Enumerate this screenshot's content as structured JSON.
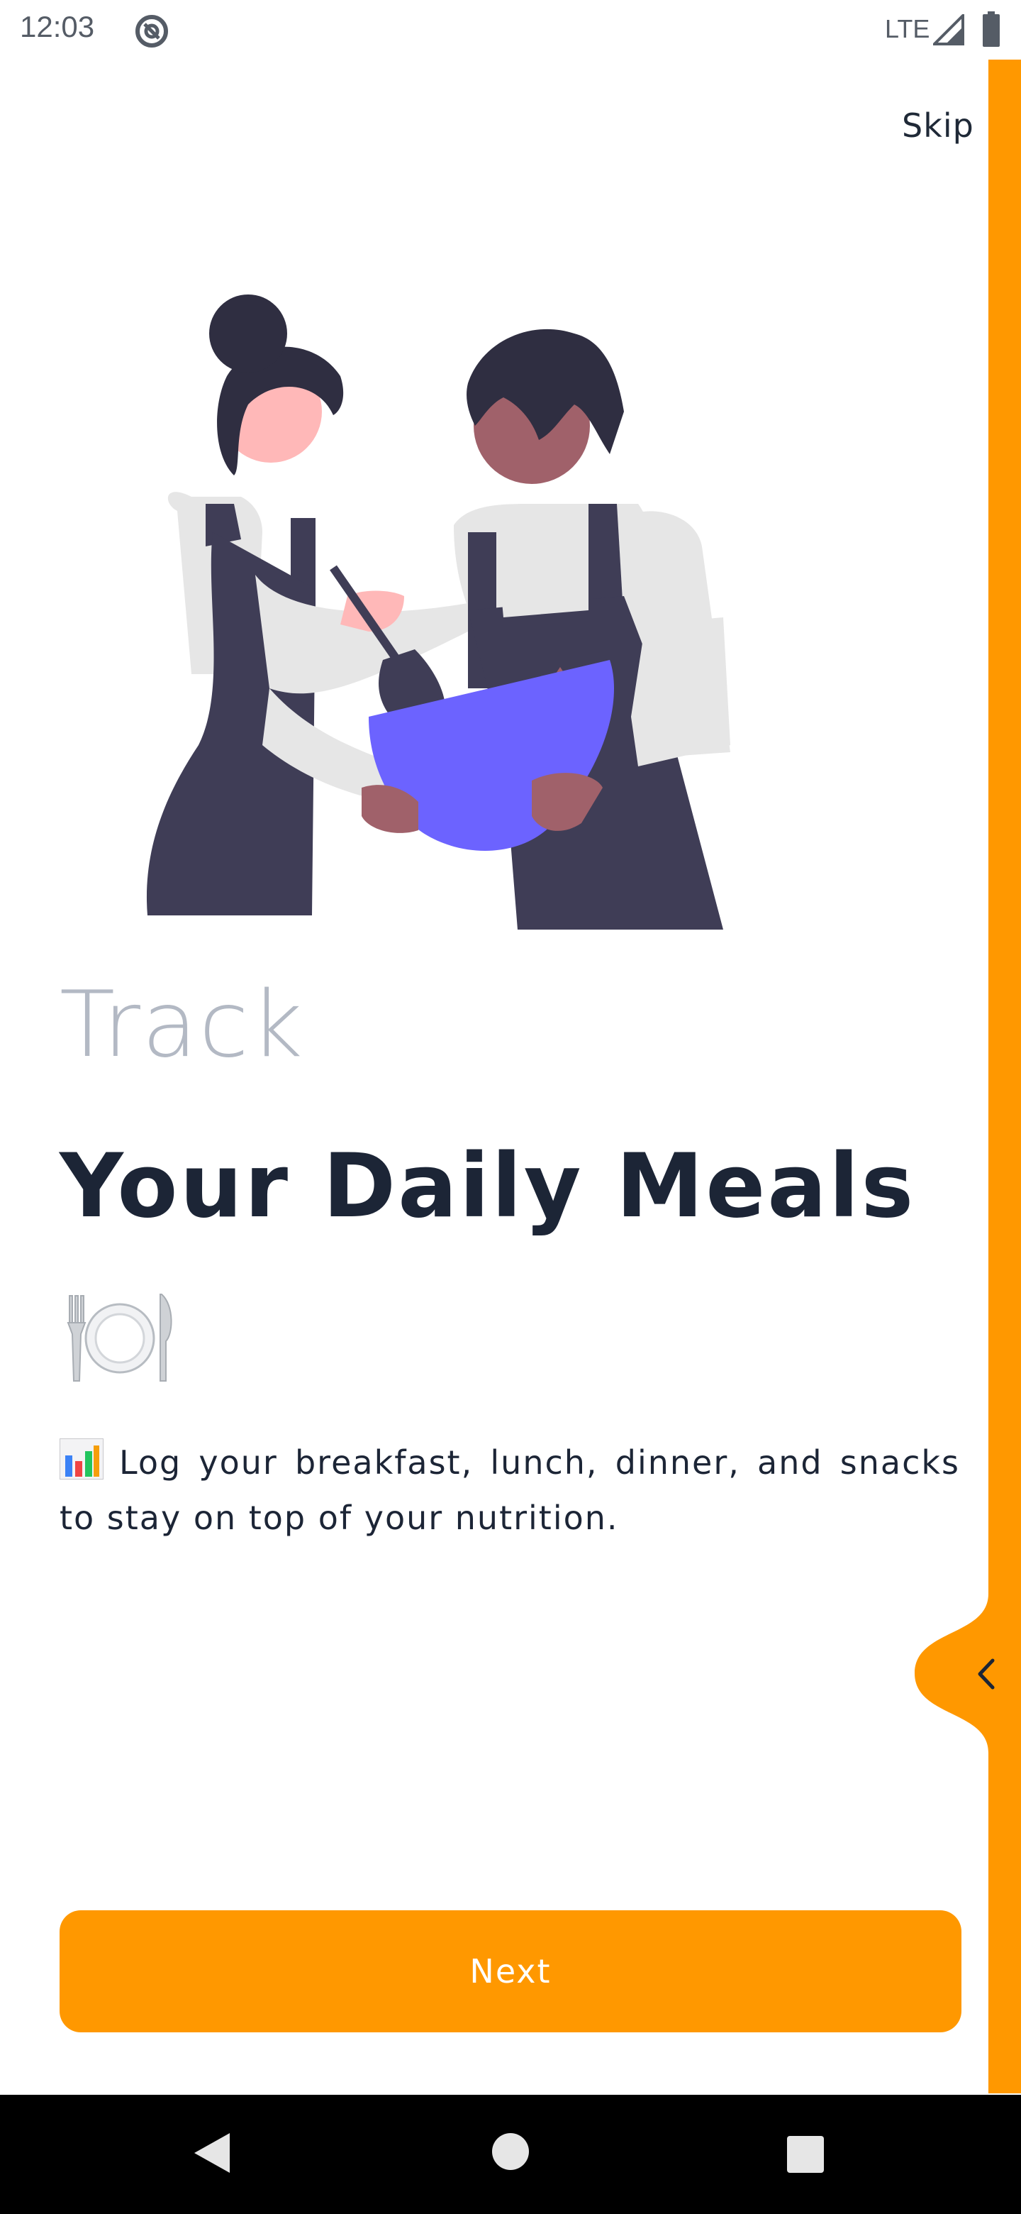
{
  "status_bar": {
    "time": "12:03",
    "network": "LTE"
  },
  "onboarding": {
    "skip_label": "Skip",
    "subtitle": "Track",
    "title": "Your Daily Meals",
    "description": "Log your breakfast, lunch, dinner, and snacks to stay on top of your nutrition.",
    "next_label": "Next"
  },
  "icons": {
    "status_left": "do-not-disturb-icon",
    "signal": "signal-icon",
    "battery": "battery-icon",
    "meal": "fork-knife-plate-icon",
    "description_lead": "bar-chart-icon",
    "back_tab": "chevron-left-icon"
  },
  "colors": {
    "accent": "#ff9800",
    "title": "#1c2536",
    "subtitle": "#b3b9c4",
    "bowl": "#6c63ff",
    "apron": "#3f3d56"
  }
}
